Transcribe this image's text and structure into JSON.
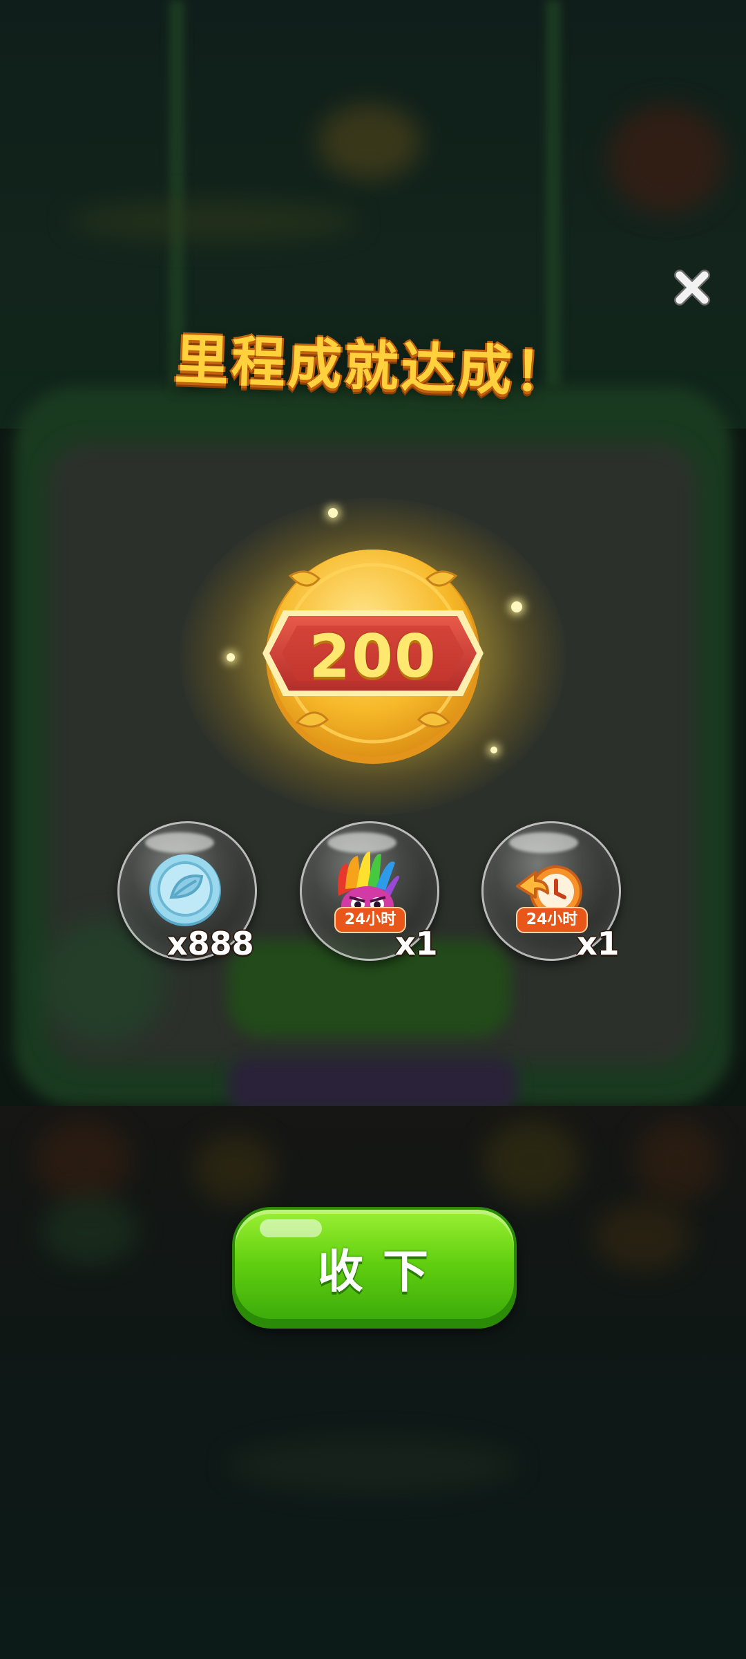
{
  "dialog": {
    "title": "里程成就达成！",
    "milestone": "200"
  },
  "rewards": [
    {
      "icon": "coin-icon",
      "count": "x888",
      "tag": ""
    },
    {
      "icon": "rainbow-owl-icon",
      "count": "x1",
      "tag": "24小时"
    },
    {
      "icon": "time-boost-icon",
      "count": "x1",
      "tag": "24小时"
    }
  ],
  "buttons": {
    "collect_label": "收下",
    "close_icon": "close-icon"
  },
  "colors": {
    "title_fill": "#ffd23d",
    "button_green": "#62d010",
    "medal_gold": "#f7b92a",
    "medal_banner": "#d9403a"
  }
}
